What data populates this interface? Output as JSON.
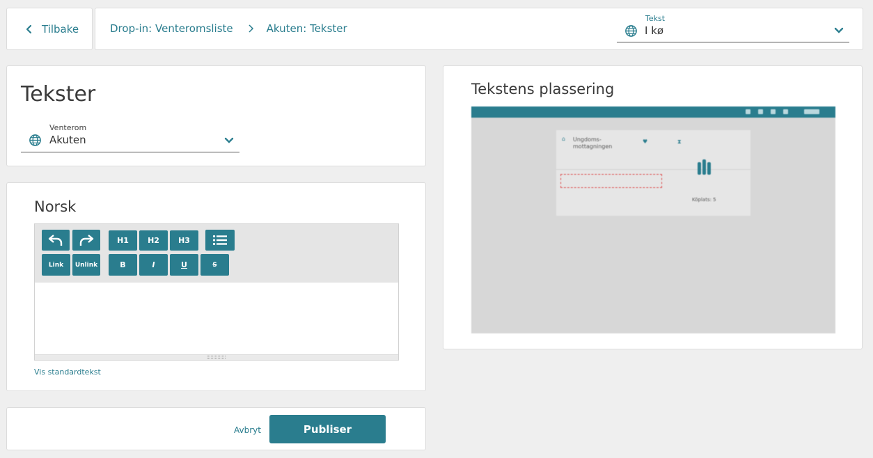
{
  "nav": {
    "back_label": "Tilbake",
    "breadcrumb": [
      "Drop-in: Venteromsliste",
      "Akuten: Tekster"
    ]
  },
  "tekst_select": {
    "label": "Tekst",
    "value": "I kø"
  },
  "tekster": {
    "title": "Tekster",
    "venterom_label": "Venterom",
    "venterom_value": "Akuten"
  },
  "editor": {
    "language_title": "Norsk",
    "toolbar": {
      "undo": "undo-icon",
      "redo": "redo-icon",
      "h1": "H1",
      "h2": "H2",
      "h3": "H3",
      "list": "list-icon",
      "link": "Link",
      "unlink": "Unlink",
      "bold": "B",
      "italic": "I",
      "underline": "U",
      "strike": "S"
    },
    "content": "",
    "show_default_text": "Vis standardtekst"
  },
  "actions": {
    "cancel": "Avbryt",
    "publish": "Publiser"
  },
  "preview": {
    "title": "Tekstens plassering",
    "clinic_name": "Ungdoms-\nmottagningen",
    "queue_label": "Köplats: 5"
  },
  "colors": {
    "accent": "#2a7d8e",
    "background": "#efefef"
  }
}
